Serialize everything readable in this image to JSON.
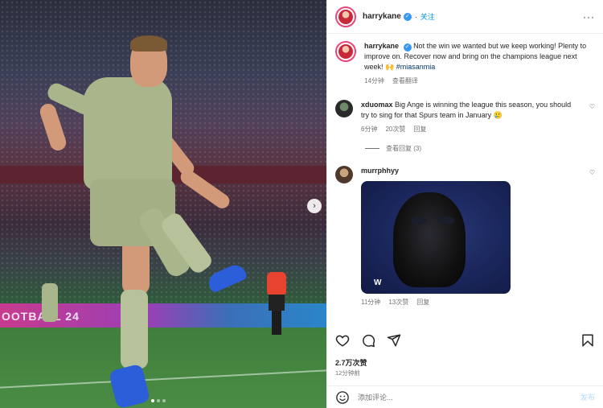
{
  "post": {
    "author": "harrykane",
    "follow_label": "关注",
    "caption_text": "Not the win we wanted but we keep working! Plenty to improve on. Recover now and bring on the champions league next week! 🙌",
    "caption_tag": "#miasanmia",
    "caption_time": "14分钟",
    "caption_translate": "查看翻译",
    "photo_ad_text": "OOTBALL 24",
    "carousel_dots": 3,
    "likes": "2.7万次赞",
    "posted_ago": "12分钟前"
  },
  "comments": [
    {
      "user": "xduomax",
      "text": "Big Ange is winning the league this season, you should try to sing for that Spurs team in January 🥲",
      "time": "6分钟",
      "likes": "20次赞",
      "reply": "回复"
    },
    {
      "user": "murrphhyy",
      "gif_label": "W",
      "time": "11分钟",
      "likes": "13次赞",
      "reply": "回复"
    }
  ],
  "view_replies": "查看回复 (3)",
  "composer": {
    "placeholder": "添加评论...",
    "post_label": "发布"
  },
  "icons": {
    "verified": "verified-badge",
    "like": "heart-icon",
    "comment": "comment-icon",
    "share": "send-icon",
    "save": "bookmark-icon",
    "emoji": "emoji-icon",
    "next": "chevron-right-icon"
  },
  "colors": {
    "verified": "#3897f0",
    "follow": "#0095f6",
    "post_disabled": "#b3dbff",
    "kit_green": "#a9b58a",
    "boot_blue": "#2b5ed8"
  }
}
